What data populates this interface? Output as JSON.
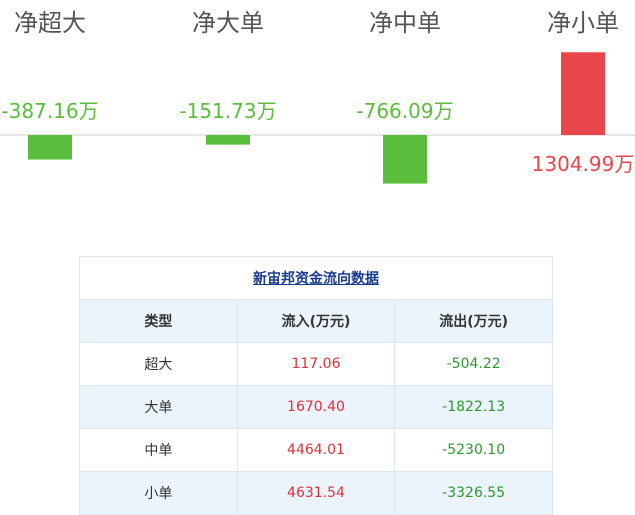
{
  "chart_data": {
    "type": "bar",
    "categories": [
      "净超大",
      "净大单",
      "净中单",
      "净小单"
    ],
    "values": [
      -387.16,
      -151.73,
      -766.09,
      1304.99
    ],
    "value_labels": [
      "-387.16万",
      "-151.73万",
      "-766.09万",
      "1304.99万"
    ],
    "ylim": [
      -1000,
      1700
    ],
    "colors": {
      "positive": "#e8464b",
      "negative": "#5bbd3c",
      "baseline": "#cccccc"
    }
  },
  "table": {
    "title": "新宙邦资金流向数据",
    "headers": [
      "类型",
      "流入(万元)",
      "流出(万元)"
    ],
    "rows": [
      {
        "type": "超大",
        "inflow": "117.06",
        "outflow": "-504.22"
      },
      {
        "type": "大单",
        "inflow": "1670.40",
        "outflow": "-1822.13"
      },
      {
        "type": "中单",
        "inflow": "4464.01",
        "outflow": "-5230.10"
      },
      {
        "type": "小单",
        "inflow": "4631.54",
        "outflow": "-3326.55"
      }
    ],
    "colors": {
      "inflow": "#e0313a",
      "outflow": "#2e9a2e",
      "title": "#1a3d8f",
      "header_bg": "#ebf3fc"
    }
  }
}
